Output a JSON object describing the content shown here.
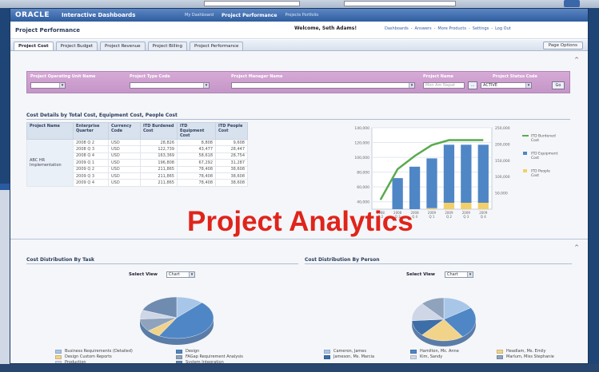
{
  "app": {
    "logo": "ORACLE",
    "title": "Interactive Dashboards",
    "nav": [
      "My Dashboard",
      "Project Performance",
      "Projects Portfolio"
    ],
    "active_nav_index": 1
  },
  "header": {
    "page_title": "Project Performance",
    "welcome": "Welcome, Seth Adams!",
    "links": [
      "Dashboards",
      "Answers",
      "More Products",
      "Settings",
      "Log Out"
    ]
  },
  "tabs": {
    "items": [
      "Project Cost",
      "Project Budget",
      "Project Revenue",
      "Project Billing",
      "Project Performance"
    ],
    "active_index": 0,
    "page_options": "Page Options"
  },
  "prompts": {
    "labels": {
      "operating_unit": "Project Operating Unit Name",
      "type_code": "Project Type Code",
      "manager": "Project Manager Name",
      "name": "Project Name",
      "status": "Project Status Code"
    },
    "name_placeholder": "Mon Am Napat",
    "status_value": "ACTIVE",
    "browse_label": "...",
    "go_label": "Go"
  },
  "cost_details": {
    "title": "Cost Details by Total Cost, Equipment Cost, People Cost",
    "columns": [
      "Project Name",
      "Enterprise Quarter",
      "Currency Code",
      "ITD Burdened Cost",
      "ITD Equipment Cost",
      "ITD People Cost"
    ],
    "project_name": "ABC HR Implementation",
    "rows": [
      [
        "2008 Q 2",
        "USD",
        "28,826",
        "8,808",
        "9,608"
      ],
      [
        "2008 Q 3",
        "USD",
        "122,739",
        "43,477",
        "28,447"
      ],
      [
        "2008 Q 4",
        "USD",
        "163,369",
        "58,618",
        "28,754"
      ],
      [
        "2009 Q 1",
        "USD",
        "196,808",
        "67,292",
        "31,287"
      ],
      [
        "2009 Q 2",
        "USD",
        "211,865",
        "78,408",
        "38,608"
      ],
      [
        "2009 Q 3",
        "USD",
        "211,865",
        "78,408",
        "38,608"
      ],
      [
        "2009 Q 4",
        "USD",
        "211,865",
        "78,408",
        "38,608"
      ]
    ]
  },
  "chart_data": {
    "type": "bar",
    "categories": [
      "2008 Q 2",
      "2008 Q 3",
      "2008 Q 4",
      "2009 Q 1",
      "2009 Q 2",
      "2009 Q 3",
      "2009 Q 4"
    ],
    "series": [
      {
        "name": "ITD Burdened Cost",
        "kind": "line",
        "axis": "right",
        "color": "#5aaa4f",
        "values": [
          28826,
          122739,
          163369,
          196808,
          211865,
          211865,
          211865
        ]
      },
      {
        "name": "ITD Equipment Cost",
        "kind": "bar",
        "axis": "left",
        "color": "#4f86c6",
        "values": [
          8808,
          43477,
          58618,
          67292,
          78408,
          78408,
          78408
        ]
      },
      {
        "name": "ITD People Cost",
        "kind": "bar",
        "axis": "left",
        "color": "#f3cf68",
        "values": [
          9608,
          28447,
          28754,
          31287,
          38608,
          38608,
          38608
        ]
      }
    ],
    "left_axis": {
      "ticks": [
        "40,000",
        "60,000",
        "80,000",
        "100,000",
        "120,000",
        "140,000"
      ],
      "min": 30000,
      "max": 140000
    },
    "right_axis": {
      "ticks": [
        "50,000",
        "100,000",
        "150,000",
        "200,000",
        "250,000"
      ],
      "min": 0,
      "max": 250000
    },
    "legend_position": "right",
    "grid": true
  },
  "cost_by_task": {
    "title": "Cost Distribution By Task",
    "select_view_label": "Select View",
    "select_view_value": "Chart",
    "legend": [
      {
        "label": "Business Requirements (Detailed)",
        "color": "#a8c6e8"
      },
      {
        "label": "Design",
        "color": "#4f86c6"
      },
      {
        "label": "Design Custom Reports",
        "color": "#f1d48a"
      },
      {
        "label": "FAGap Requirement Analysis",
        "color": "#8fa3bd"
      },
      {
        "label": "Production",
        "color": "#cfd6e6"
      },
      {
        "label": "System Integration",
        "color": "#6f8cb0"
      }
    ]
  },
  "cost_by_person": {
    "title": "Cost Distribution By Person",
    "select_view_label": "Select View",
    "select_view_value": "Chart",
    "legend": [
      {
        "label": "Cameron, James",
        "color": "#a8c6e8"
      },
      {
        "label": "Hamilton, Ms. Anne",
        "color": "#4f86c6"
      },
      {
        "label": "Headlam, Ms. Emily",
        "color": "#f1d48a"
      },
      {
        "label": "Jameson, Ms. Marcia",
        "color": "#3e6ea8"
      },
      {
        "label": "Kim, Sandy",
        "color": "#cfd6e6"
      },
      {
        "label": "Marlum, Miss Stephanie",
        "color": "#8fa3bd"
      }
    ]
  },
  "watermark": "Project Analytics"
}
